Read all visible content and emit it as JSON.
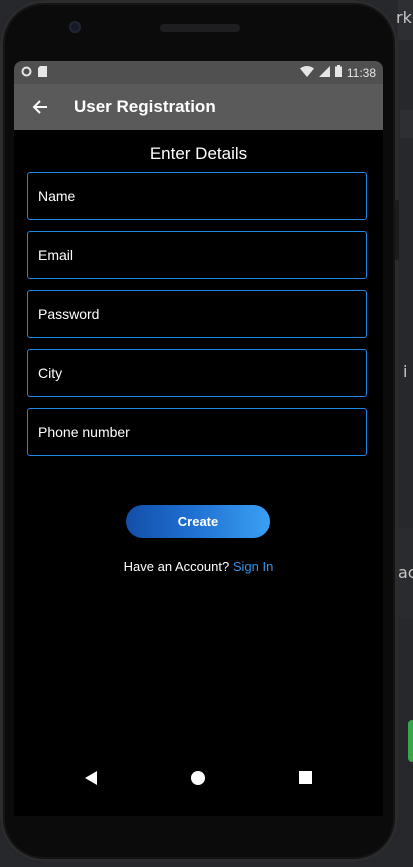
{
  "status_bar": {
    "time": "11:38"
  },
  "app_bar": {
    "title": "User Registration"
  },
  "form": {
    "heading": "Enter Details",
    "fields": [
      {
        "label": "Name"
      },
      {
        "label": "Email"
      },
      {
        "label": "Password"
      },
      {
        "label": "City"
      },
      {
        "label": "Phone number"
      }
    ],
    "create_label": "Create",
    "account_prompt": "Have an Account?",
    "sign_in_label": "Sign In"
  },
  "background_fragments": {
    "top_right": "rk",
    "mid_right_1": "i",
    "mid_right_2": "ac"
  },
  "colors": {
    "accent": "#1e88e5",
    "link": "#2e93e6",
    "app_bar": "#5a5a5a",
    "status_bar": "#505050"
  },
  "icons": [
    "back-arrow-icon",
    "wifi-icon",
    "signal-icon",
    "battery-icon",
    "nav-back-icon",
    "nav-home-icon",
    "nav-recents-icon"
  ]
}
